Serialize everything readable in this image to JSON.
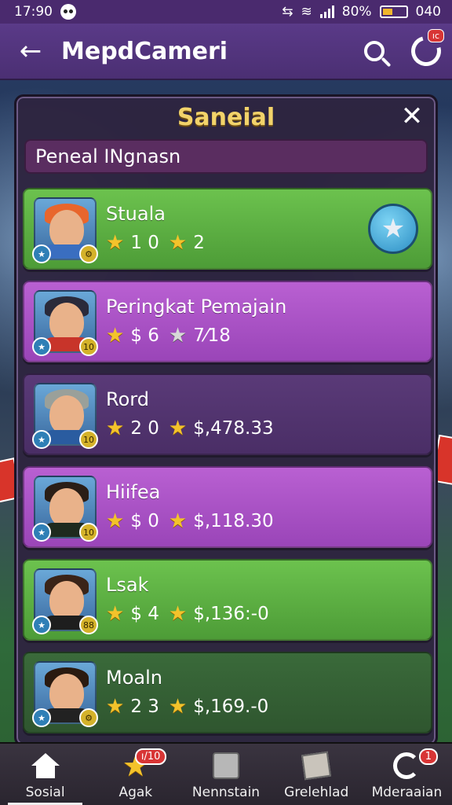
{
  "status_bar": {
    "time": "17:90",
    "battery": "80%",
    "extra": "040"
  },
  "app_bar": {
    "title": "MepdCameri",
    "refresh_badge": "ıc"
  },
  "panel": {
    "title": "Saneial",
    "subtitle": "Peneal INgnasn"
  },
  "rows": [
    {
      "name": "Stuala",
      "stat1": "1 0",
      "stat2": "2",
      "color": "green",
      "hair": "#e8662c",
      "shirt": "#3a6ec0",
      "badge_r": "⚙",
      "has_fav": true
    },
    {
      "name": "Peringkat Pemajain",
      "stat1": "$ 6",
      "stat2": "7⁄18",
      "color": "purple",
      "hair": "#2a2a3a",
      "shirt": "#c8342a",
      "badge_r": "10",
      "has_fav": false
    },
    {
      "name": "Rord",
      "stat1": "2 0",
      "stat2": "$,478.33",
      "color": "dark",
      "hair": "#9aa09a",
      "shirt": "#2a5ca0",
      "badge_r": "10",
      "has_fav": false
    },
    {
      "name": "Hiifea",
      "stat1": "$ 0",
      "stat2": "$,118.30",
      "color": "purple",
      "hair": "#2a1e16",
      "shirt": "#1e2a1e",
      "badge_r": "10",
      "has_fav": false
    },
    {
      "name": "Lsak",
      "stat1": "$ 4",
      "stat2": "$,136:-0",
      "color": "green",
      "hair": "#3a2418",
      "shirt": "#1e1e1e",
      "badge_r": "88",
      "has_fav": false
    },
    {
      "name": "Moaln",
      "stat1": "2 3",
      "stat2": "$,169.-0",
      "color": "dkgreen",
      "hair": "#2a1a10",
      "shirt": "#222",
      "badge_r": "⚙",
      "has_fav": false
    }
  ],
  "bottom_nav": [
    {
      "label": "Sosial",
      "icon": "home-icon",
      "active": true
    },
    {
      "label": "Agak",
      "icon": "star-icon",
      "badge": "ı/10"
    },
    {
      "label": "Nennstain",
      "icon": "box-icon"
    },
    {
      "label": "Grelehlad",
      "icon": "package-icon"
    },
    {
      "label": "Mderaaian",
      "icon": "cycle-icon",
      "badge": "1"
    }
  ]
}
